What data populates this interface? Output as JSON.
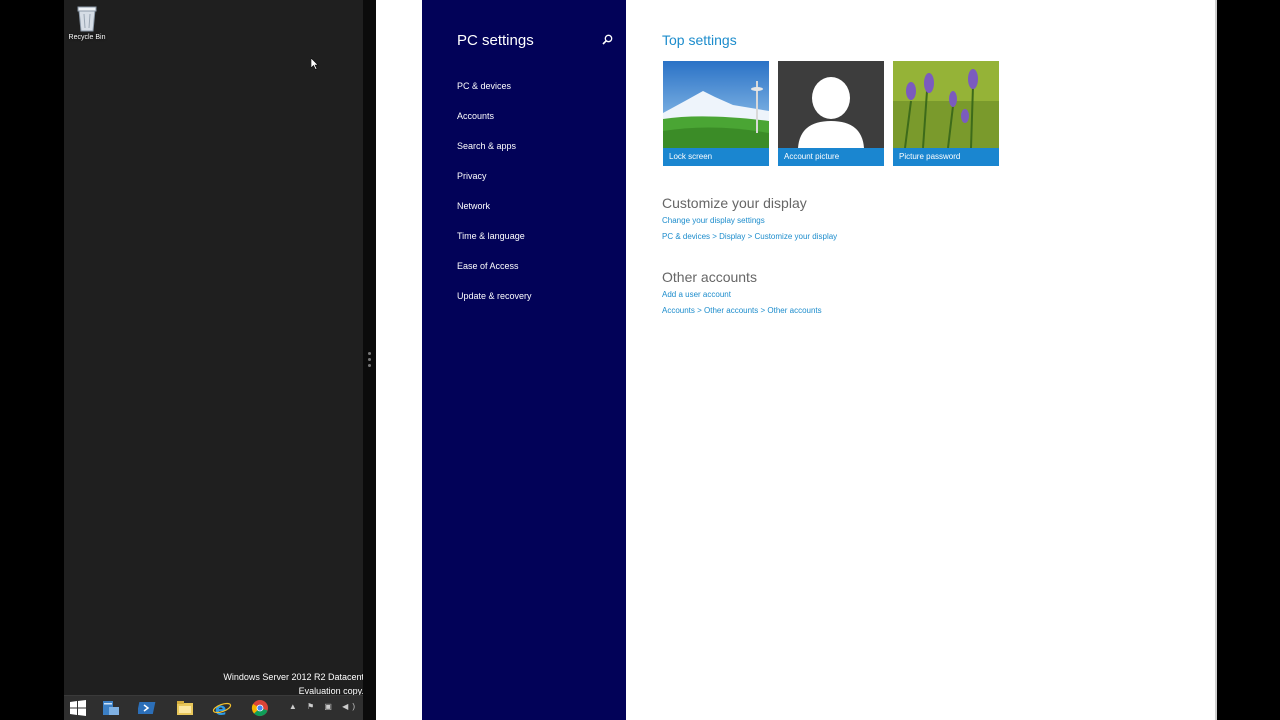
{
  "desktop": {
    "recycle_bin_label": "Recycle Bin",
    "watermark_line1": "Windows Server 2012 R2 Datacent",
    "watermark_line2": "Evaluation copy.",
    "taskbar_icons": [
      "start-icon",
      "server-manager-icon",
      "powershell-icon",
      "file-explorer-icon",
      "internet-explorer-icon",
      "chrome-icon"
    ]
  },
  "nav": {
    "title": "PC settings",
    "items": [
      {
        "label": "PC & devices"
      },
      {
        "label": "Accounts"
      },
      {
        "label": "Search & apps"
      },
      {
        "label": "Privacy"
      },
      {
        "label": "Network"
      },
      {
        "label": "Time & language"
      },
      {
        "label": "Ease of Access"
      },
      {
        "label": "Update & recovery"
      }
    ]
  },
  "main": {
    "top_settings_title": "Top settings",
    "tiles": [
      {
        "label": "Lock screen"
      },
      {
        "label": "Account picture"
      },
      {
        "label": "Picture password"
      }
    ],
    "customize": {
      "heading": "Customize your display",
      "link": "Change your display settings",
      "path": "PC & devices > Display > Customize your display"
    },
    "other_accounts": {
      "heading": "Other accounts",
      "link": "Add a user account",
      "path": "Accounts > Other accounts > Other accounts"
    }
  },
  "colors": {
    "nav_bg": "#020258",
    "accent": "#1c8ccc",
    "tile_caption": "#1a86d0"
  }
}
